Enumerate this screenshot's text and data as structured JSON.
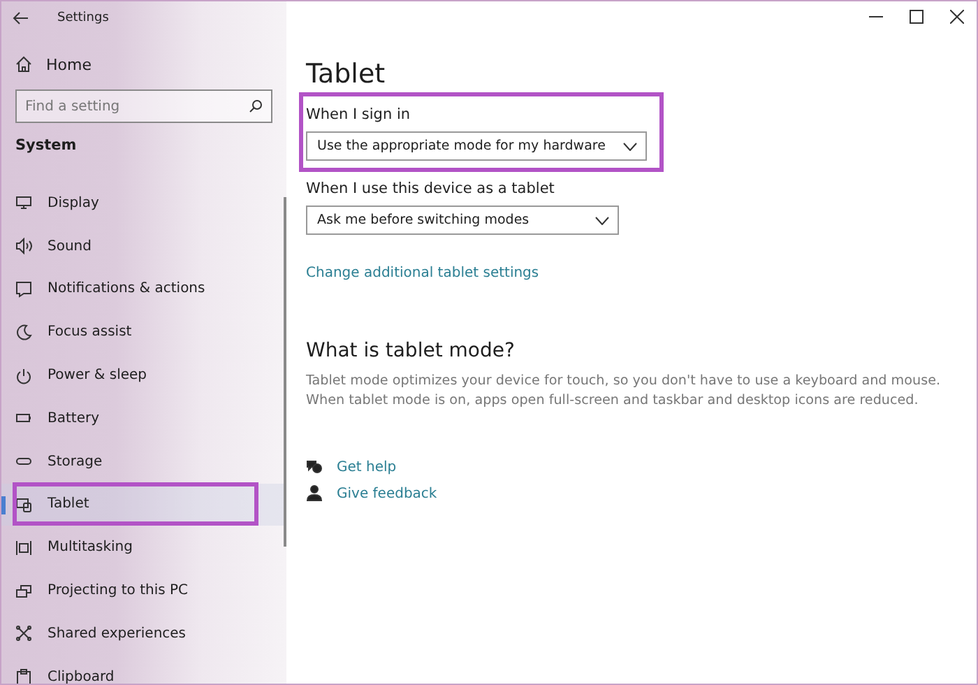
{
  "window": {
    "title": "Settings"
  },
  "sidebar": {
    "home": "Home",
    "search": {
      "placeholder": "Find a setting"
    },
    "section": "System",
    "items": [
      {
        "label": "Display",
        "selected": false,
        "highlighted": false
      },
      {
        "label": "Sound",
        "selected": false,
        "highlighted": false
      },
      {
        "label": "Notifications & actions",
        "selected": false,
        "highlighted": false
      },
      {
        "label": "Focus assist",
        "selected": false,
        "highlighted": false
      },
      {
        "label": "Power & sleep",
        "selected": false,
        "highlighted": false
      },
      {
        "label": "Battery",
        "selected": false,
        "highlighted": false
      },
      {
        "label": "Storage",
        "selected": false,
        "highlighted": false
      },
      {
        "label": "Tablet",
        "selected": true,
        "highlighted": true
      },
      {
        "label": "Multitasking",
        "selected": false,
        "highlighted": false
      },
      {
        "label": "Projecting to this PC",
        "selected": false,
        "highlighted": false
      },
      {
        "label": "Shared experiences",
        "selected": false,
        "highlighted": false
      },
      {
        "label": "Clipboard",
        "selected": false,
        "highlighted": false
      }
    ]
  },
  "page": {
    "title": "Tablet",
    "settings": [
      {
        "label": "When I sign in",
        "value": "Use the appropriate mode for my hardware",
        "highlighted": true
      },
      {
        "label": "When I use this device as a tablet",
        "value": "Ask me before switching modes",
        "highlighted": false
      }
    ],
    "link": "Change additional tablet settings",
    "info": {
      "title": "What is tablet mode?",
      "text": "Tablet mode optimizes your device for touch, so you don't have to use a keyboard and mouse. When tablet mode is on, apps open full-screen and taskbar and desktop icons are reduced."
    },
    "help_links": [
      "Get help",
      "Give feedback"
    ]
  }
}
